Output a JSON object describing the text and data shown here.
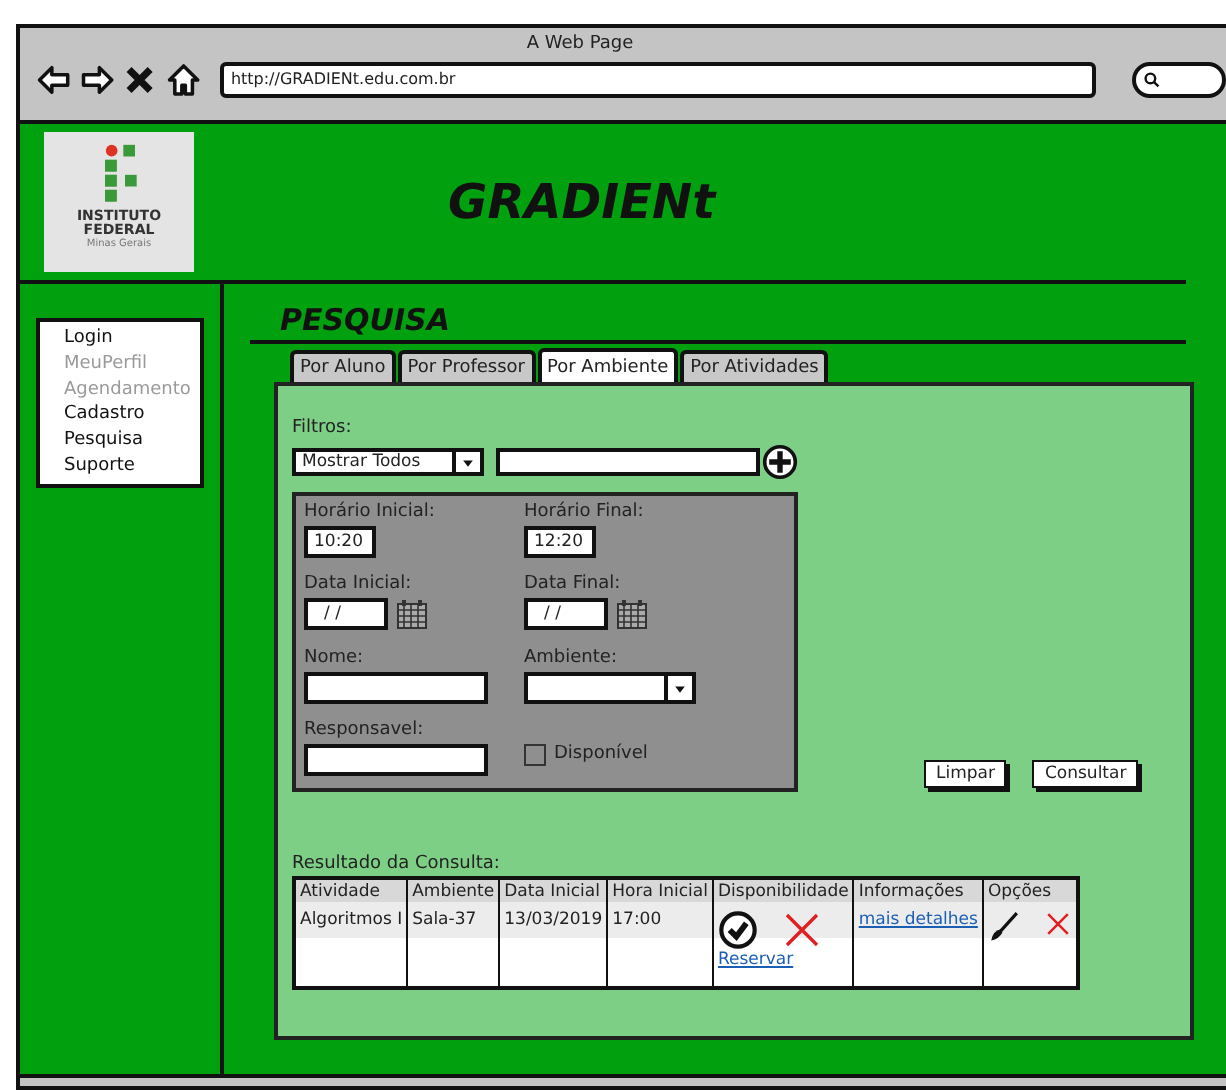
{
  "browser": {
    "title": "A Web Page",
    "url": "http://GRADIENt.edu.com.br"
  },
  "logo": {
    "lines": [
      "INSTITUTO",
      "FEDERAL"
    ],
    "subtitle": "Minas Gerais"
  },
  "site_title": "GRADIENt",
  "menu": [
    {
      "label": "Login",
      "disabled": false
    },
    {
      "label": "MeuPerfil",
      "disabled": true
    },
    {
      "label": "Agendamento",
      "disabled": true
    },
    {
      "label": "Cadastro",
      "disabled": false
    },
    {
      "label": "Pesquisa",
      "disabled": false
    },
    {
      "label": "Suporte",
      "disabled": false
    }
  ],
  "section_title": "PESQUISA",
  "tabs": [
    {
      "label": "Por Aluno",
      "selected": false
    },
    {
      "label": "Por Professor",
      "selected": false
    },
    {
      "label": "Por Ambiente",
      "selected": true
    },
    {
      "label": "Por Atividades",
      "selected": false
    }
  ],
  "filters": {
    "label": "Filtros:",
    "dropdown": "Mostrar Todos"
  },
  "form": [
    {
      "kind": "time",
      "label": "Horário Inicial:",
      "value": "10:20"
    },
    {
      "kind": "time",
      "label": "Horário Final:",
      "value": "12:20"
    },
    {
      "kind": "date",
      "label": "Data Inicial:",
      "value": "/ /"
    },
    {
      "kind": "date",
      "label": "Data Final:",
      "value": "/ /"
    },
    {
      "kind": "text",
      "label": "Nome:"
    },
    {
      "kind": "select",
      "label": "Ambiente:"
    },
    {
      "kind": "text",
      "label": "Responsavel:"
    },
    {
      "kind": "checkbox",
      "label": "Disponível",
      "checked": false
    }
  ],
  "buttons": [
    "Limpar",
    "Consultar"
  ],
  "results": {
    "label": "Resultado da Consulta:",
    "columns": [
      "Atividade",
      "Ambiente",
      "Data Inicial",
      "Hora Inicial",
      "Disponibilidade",
      "Informações",
      "Opções"
    ],
    "rows": [
      {
        "cells": [
          {
            "kind": "text",
            "text": "Algoritmos I"
          },
          {
            "kind": "text",
            "text": "Sala-37"
          },
          {
            "kind": "text",
            "text": "13/03/2019"
          },
          {
            "kind": "text",
            "text": "17:00"
          },
          {
            "kind": "availability",
            "link": "Reservar"
          },
          {
            "kind": "link",
            "text": "mais detalhes"
          },
          {
            "kind": "actions"
          }
        ]
      }
    ]
  }
}
